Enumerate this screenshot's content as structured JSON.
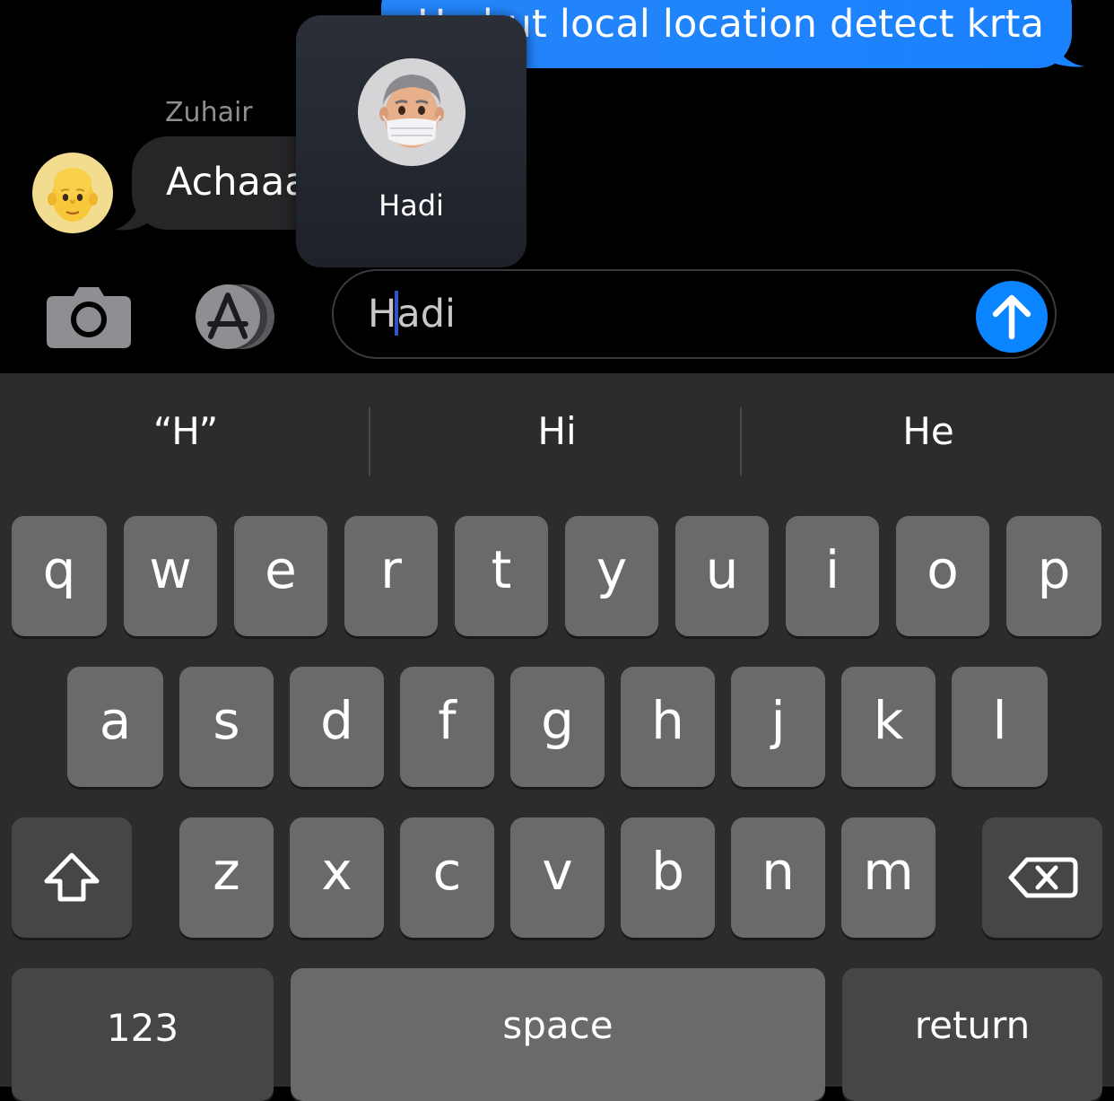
{
  "chat": {
    "sent_message": "Ha but local location detect krta",
    "sender_name": "Zuhair",
    "received_message": "Achaaa"
  },
  "mention_popup": {
    "contact_name": "Hadi"
  },
  "composer": {
    "text_before_caret": "H",
    "text_after_caret": "adi",
    "camera_icon": "camera-icon",
    "appstore_icon": "app-store-icon",
    "send_icon": "arrow-up-icon"
  },
  "keyboard": {
    "suggestions": [
      "“H”",
      "Hi",
      "He"
    ],
    "row1": [
      "q",
      "w",
      "e",
      "r",
      "t",
      "y",
      "u",
      "i",
      "o",
      "p"
    ],
    "row2": [
      "a",
      "s",
      "d",
      "f",
      "g",
      "h",
      "j",
      "k",
      "l"
    ],
    "row3": [
      "z",
      "x",
      "c",
      "v",
      "b",
      "n",
      "m"
    ],
    "numbers_label": "123",
    "space_label": "space",
    "return_label": "return",
    "shift_icon": "shift-icon",
    "delete_icon": "delete-icon"
  },
  "colors": {
    "accent": "#0a84ff",
    "key": "#6a6a6c",
    "key_dark": "#464648",
    "keyboard_bg": "#2c2c2e"
  }
}
